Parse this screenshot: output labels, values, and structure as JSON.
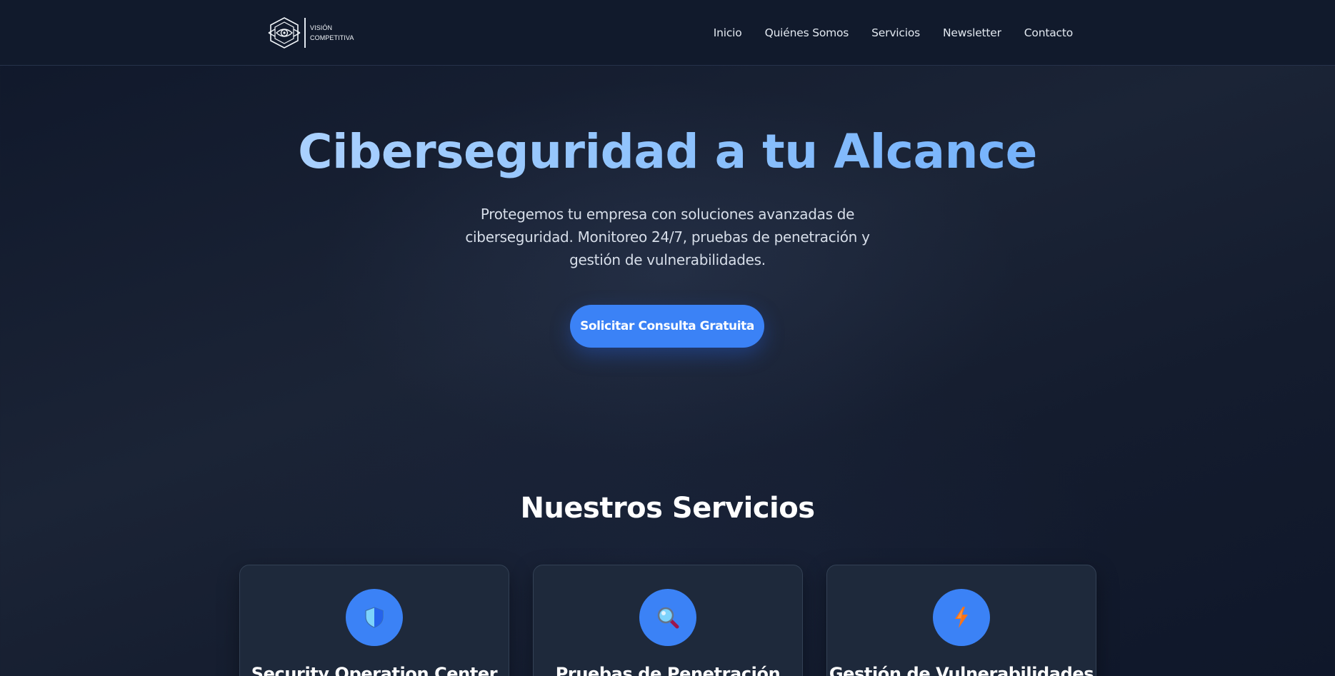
{
  "brand": {
    "line1": "VISIÓN",
    "line2": "COMPETITIVA",
    "logo_icon": "hexagon-eye-logo"
  },
  "nav": {
    "items": [
      {
        "label": "Inicio"
      },
      {
        "label": "Quiénes Somos"
      },
      {
        "label": "Servicios"
      },
      {
        "label": "Newsletter"
      },
      {
        "label": "Contacto"
      }
    ]
  },
  "hero": {
    "title": "Ciberseguridad a tu Alcance",
    "subtitle": "Protegemos tu empresa con soluciones avanzadas de ciberseguridad. Monitoreo 24/7, pruebas de penetración y gestión de vulnerabilidades.",
    "cta_label": "Solicitar Consulta Gratuita"
  },
  "services": {
    "title": "Nuestros Servicios",
    "cards": [
      {
        "title": "Security Operation Center",
        "icon": "shield-icon"
      },
      {
        "title": "Pruebas de Penetración",
        "icon": "magnifier-icon"
      },
      {
        "title": "Gestión de Vulnerabilidades",
        "icon": "lightning-icon"
      }
    ]
  },
  "colors": {
    "accent": "#3b82f6",
    "background": "#0f172a",
    "card": "#1e293b",
    "title_gradient_start": "#bfdbfe",
    "title_gradient_end": "#60a5fa"
  }
}
